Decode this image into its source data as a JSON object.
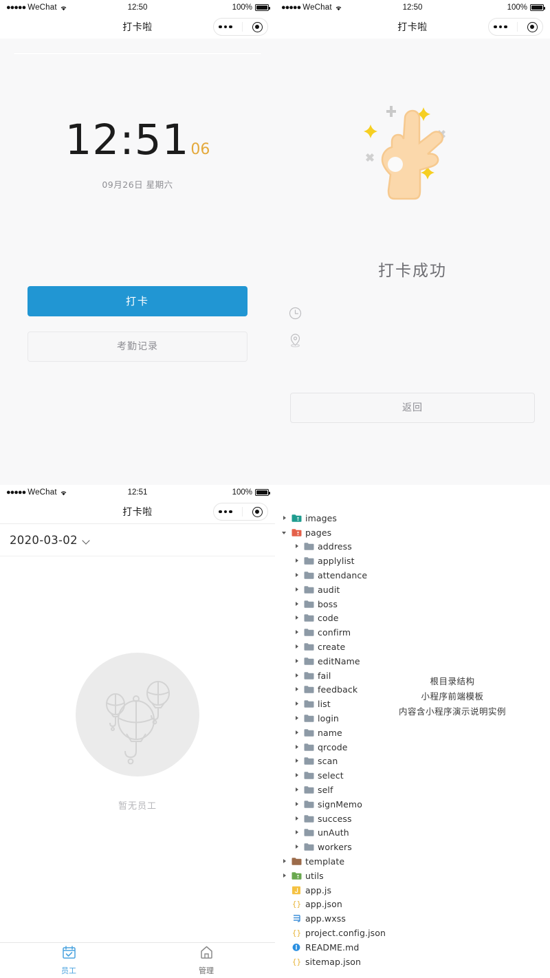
{
  "colors": {
    "primary_blue": "#2196d3",
    "tab_active": "#4aa3df",
    "seconds_orange": "#e4a93c",
    "panel_bg": "#f8f8f9",
    "empty_circle": "#ebebeb"
  },
  "panel_clock": {
    "status": {
      "carrier": "WeChat",
      "dots": "●●●●●",
      "time": "12:50",
      "battery": "100%"
    },
    "nav": {
      "title": "打卡啦"
    },
    "clock": {
      "time": "12:51",
      "seconds": "06",
      "date": "09月26日 星期六"
    },
    "buttons": {
      "primary": "打卡",
      "secondary": "考勤记录"
    }
  },
  "panel_success": {
    "status": {
      "carrier": "WeChat",
      "dots": "●●●●●",
      "time": "12:50",
      "battery": "100%"
    },
    "nav": {
      "title": "打卡啦"
    },
    "heading": "打卡成功",
    "meta": [
      {
        "icon": "clock-icon",
        "text": ""
      },
      {
        "icon": "location-pin-icon",
        "text": ""
      }
    ],
    "back_button": "返回"
  },
  "panel_employees": {
    "status": {
      "carrier": "WeChat",
      "dots": "●●●●●",
      "time": "12:51",
      "battery": "100%"
    },
    "nav": {
      "title": "打卡啦"
    },
    "date_picker": {
      "value": "2020-03-02"
    },
    "empty_state": {
      "label": "暂无员工"
    },
    "tabs": [
      {
        "label": "员工",
        "icon": "calendar-check-icon",
        "active": true
      },
      {
        "label": "管理",
        "icon": "home-icon",
        "active": false
      }
    ]
  },
  "panel_filetree": {
    "annotation": "根目录结构\n小程序前端模板\n内容含小程序演示说明实例",
    "annotation_lines": [
      "根目录结构",
      "小程序前端模板",
      "内容含小程序演示说明实例"
    ],
    "items": [
      {
        "label": "images",
        "indent": 0,
        "arrow": "collapsed",
        "icon": "folder-teal-icon",
        "color": "#1f9c8f"
      },
      {
        "label": "pages",
        "indent": 0,
        "arrow": "expanded",
        "icon": "folder-red-icon",
        "color": "#e4604a"
      },
      {
        "label": "address",
        "indent": 1,
        "arrow": "collapsed",
        "icon": "folder-icon",
        "color": "#8d9aa6"
      },
      {
        "label": "applylist",
        "indent": 1,
        "arrow": "collapsed",
        "icon": "folder-icon",
        "color": "#8d9aa6"
      },
      {
        "label": "attendance",
        "indent": 1,
        "arrow": "collapsed",
        "icon": "folder-icon",
        "color": "#8d9aa6"
      },
      {
        "label": "audit",
        "indent": 1,
        "arrow": "collapsed",
        "icon": "folder-icon",
        "color": "#8d9aa6"
      },
      {
        "label": "boss",
        "indent": 1,
        "arrow": "collapsed",
        "icon": "folder-icon",
        "color": "#8d9aa6"
      },
      {
        "label": "code",
        "indent": 1,
        "arrow": "collapsed",
        "icon": "folder-icon",
        "color": "#8d9aa6"
      },
      {
        "label": "confirm",
        "indent": 1,
        "arrow": "collapsed",
        "icon": "folder-icon",
        "color": "#8d9aa6"
      },
      {
        "label": "create",
        "indent": 1,
        "arrow": "collapsed",
        "icon": "folder-icon",
        "color": "#8d9aa6"
      },
      {
        "label": "editName",
        "indent": 1,
        "arrow": "collapsed",
        "icon": "folder-icon",
        "color": "#8d9aa6"
      },
      {
        "label": "fail",
        "indent": 1,
        "arrow": "collapsed",
        "icon": "folder-icon",
        "color": "#8d9aa6"
      },
      {
        "label": "feedback",
        "indent": 1,
        "arrow": "collapsed",
        "icon": "folder-icon",
        "color": "#8d9aa6"
      },
      {
        "label": "list",
        "indent": 1,
        "arrow": "collapsed",
        "icon": "folder-icon",
        "color": "#8d9aa6"
      },
      {
        "label": "login",
        "indent": 1,
        "arrow": "collapsed",
        "icon": "folder-icon",
        "color": "#8d9aa6"
      },
      {
        "label": "name",
        "indent": 1,
        "arrow": "collapsed",
        "icon": "folder-icon",
        "color": "#8d9aa6"
      },
      {
        "label": "qrcode",
        "indent": 1,
        "arrow": "collapsed",
        "icon": "folder-icon",
        "color": "#8d9aa6"
      },
      {
        "label": "scan",
        "indent": 1,
        "arrow": "collapsed",
        "icon": "folder-icon",
        "color": "#8d9aa6"
      },
      {
        "label": "select",
        "indent": 1,
        "arrow": "collapsed",
        "icon": "folder-icon",
        "color": "#8d9aa6"
      },
      {
        "label": "self",
        "indent": 1,
        "arrow": "collapsed",
        "icon": "folder-icon",
        "color": "#8d9aa6"
      },
      {
        "label": "signMemo",
        "indent": 1,
        "arrow": "collapsed",
        "icon": "folder-icon",
        "color": "#8d9aa6"
      },
      {
        "label": "success",
        "indent": 1,
        "arrow": "collapsed",
        "icon": "folder-icon",
        "color": "#8d9aa6"
      },
      {
        "label": "unAuth",
        "indent": 1,
        "arrow": "collapsed",
        "icon": "folder-icon",
        "color": "#8d9aa6"
      },
      {
        "label": "workers",
        "indent": 1,
        "arrow": "collapsed",
        "icon": "folder-icon",
        "color": "#8d9aa6"
      },
      {
        "label": "template",
        "indent": 0,
        "arrow": "collapsed",
        "icon": "folder-brown-icon",
        "color": "#9c6b4a"
      },
      {
        "label": "utils",
        "indent": 0,
        "arrow": "collapsed",
        "icon": "folder-green-icon",
        "color": "#6aa84f"
      },
      {
        "label": "app.js",
        "indent": 0,
        "arrow": "none",
        "icon": "js-file-icon",
        "color": "#f5c243"
      },
      {
        "label": "app.json",
        "indent": 0,
        "arrow": "none",
        "icon": "json-file-icon",
        "color": "#e8b53a"
      },
      {
        "label": "app.wxss",
        "indent": 0,
        "arrow": "none",
        "icon": "css-file-icon",
        "color": "#3f8fd8"
      },
      {
        "label": "project.config.json",
        "indent": 0,
        "arrow": "none",
        "icon": "json-file-icon",
        "color": "#e8b53a"
      },
      {
        "label": "README.md",
        "indent": 0,
        "arrow": "none",
        "icon": "info-file-icon",
        "color": "#2a8fe0"
      },
      {
        "label": "sitemap.json",
        "indent": 0,
        "arrow": "none",
        "icon": "json-file-icon",
        "color": "#e8b53a"
      }
    ]
  }
}
